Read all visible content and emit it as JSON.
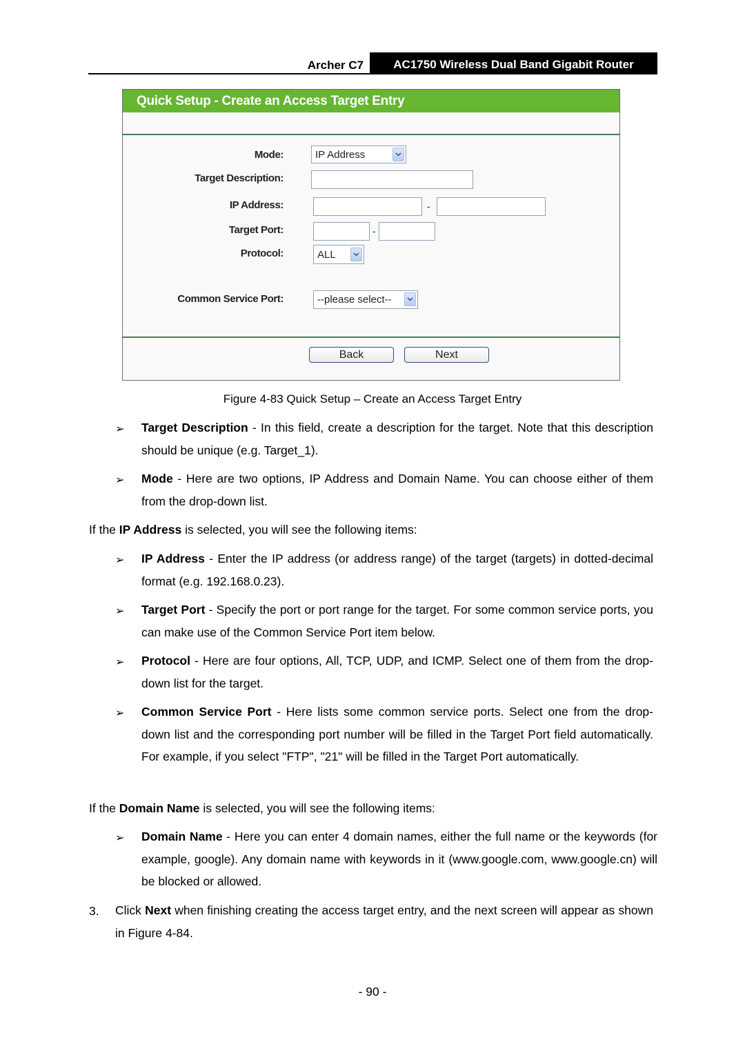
{
  "header": {
    "model": "Archer C7",
    "product": "AC1750 Wireless Dual Band Gigabit Router"
  },
  "screenshot": {
    "title": "Quick Setup - Create an Access Target Entry",
    "fields": {
      "mode": {
        "label": "Mode:",
        "value": "IP Address"
      },
      "target_description": {
        "label": "Target Description:",
        "value": ""
      },
      "ip_address": {
        "label": "IP Address:",
        "start": "",
        "separator": "-",
        "end": ""
      },
      "target_port": {
        "label": "Target Port:",
        "start": "",
        "separator": "-",
        "end": ""
      },
      "protocol": {
        "label": "Protocol:",
        "value": "ALL"
      },
      "common_service_port": {
        "label": "Common Service Port:",
        "value": "--please select--"
      }
    },
    "buttons": {
      "back": "Back",
      "next": "Next"
    },
    "colors": {
      "title_bar": "#66b632",
      "divider": "#3f7f55"
    }
  },
  "caption": "Figure 4-83 Quick Setup – Create an Access Target Entry",
  "bullet_icon": "➢",
  "items": [
    {
      "term": "Target Description",
      "text": " - In this field, create a description for the target. Note that this description should be unique (e.g. Target_1)."
    },
    {
      "term": "Mode",
      "text": " - Here are two options, IP Address and Domain Name. You can choose either of them from the drop-down list."
    }
  ],
  "ip_intro": {
    "pre": "If the ",
    "term": "IP Address",
    "post": " is selected, you will see the following items:"
  },
  "ip_items": [
    {
      "term": "IP Address",
      "text": " - Enter the IP address (or address range) of the target (targets) in dotted-decimal format (e.g. 192.168.0.23)."
    },
    {
      "term": "Target Port",
      "text": " - Specify the port or port range for the target. For some common service ports, you can make use of the Common Service Port item below."
    },
    {
      "term": "Protocol",
      "text": " - Here are four options, All, TCP, UDP, and ICMP. Select one of them from the drop-down list for the target."
    },
    {
      "term": "Common Service Port",
      "text": " - Here lists some common service ports. Select one from the drop-down list and the corresponding port number will be filled in the Target Port field automatically. For example, if you select \"FTP\", \"21\" will be filled in the Target Port automatically."
    }
  ],
  "domain_intro": {
    "pre": "If the ",
    "term": "Domain Name",
    "post": " is selected, you will see the following items:"
  },
  "domain_items": [
    {
      "term": "Domain Name",
      "text": " - Here you can enter 4 domain names, either the full name or the keywords (for example, google). Any domain name with keywords in it (www.google.com, www.google.cn) will be blocked or allowed."
    }
  ],
  "step": {
    "number": "3.",
    "pre": "Click ",
    "term": "Next",
    "post": " when finishing creating the access target entry, and the next screen will appear as shown in Figure 4-84."
  },
  "page_number": "- 90 -"
}
